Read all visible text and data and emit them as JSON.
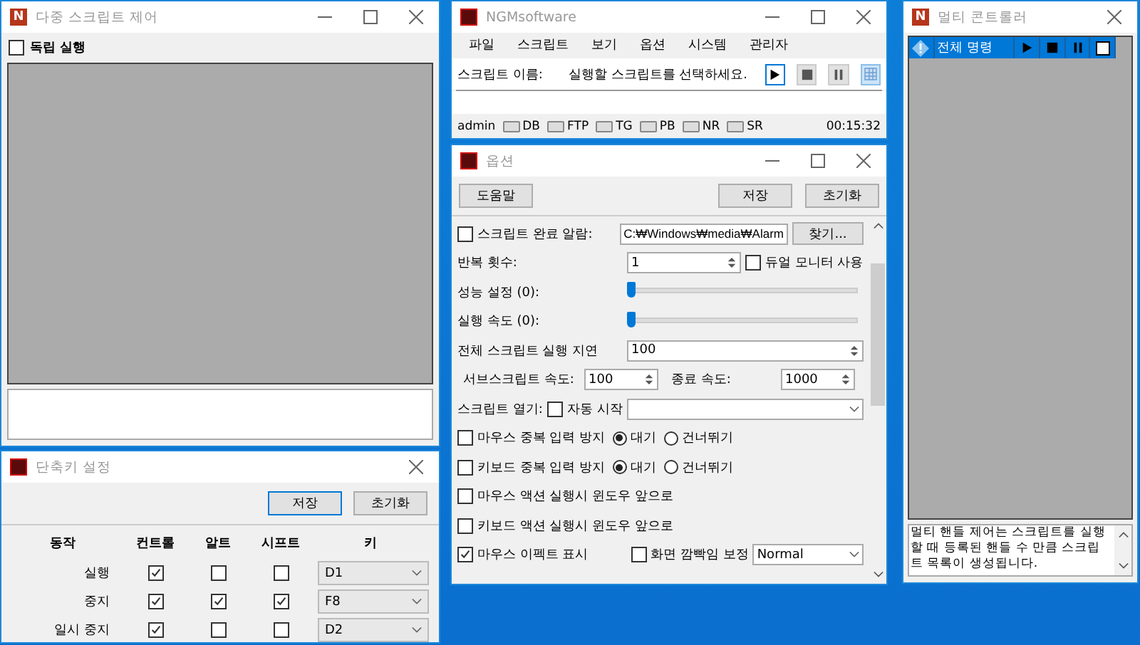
{
  "multi_script_window": {
    "icon_letter": "N",
    "title": "다중 스크립트 제어",
    "independent_run": {
      "label": "독립 실행",
      "checked": false
    }
  },
  "hotkey_window": {
    "title": "단축키 설정",
    "buttons": [
      "저장",
      "초기화"
    ],
    "columns": [
      "동작",
      "컨트롤",
      "알트",
      "시프트",
      "키"
    ],
    "rows": [
      {
        "action": "실행",
        "ctrl": true,
        "alt": false,
        "shift": false,
        "key": "D1"
      },
      {
        "action": "중지",
        "ctrl": true,
        "alt": true,
        "shift": true,
        "key": "F8"
      },
      {
        "action": "일시 중지",
        "ctrl": true,
        "alt": false,
        "shift": false,
        "key": "D2"
      }
    ]
  },
  "main_window": {
    "title": "NGMsoftware",
    "menu": [
      "파일",
      "스크립트",
      "보기",
      "옵션",
      "시스템",
      "관리자"
    ],
    "script_name_label": "스크립트 이름:",
    "script_name_value": "실행할 스크립트를 선택하세요.",
    "status_bar": {
      "user": "admin",
      "indicators": [
        "DB",
        "FTP",
        "TG",
        "PB",
        "NR",
        "SR"
      ],
      "time": "00:15:32"
    }
  },
  "options_window": {
    "title": "옵션",
    "help_button": "도움말",
    "save_button": "저장",
    "reset_button": "초기화",
    "alarm": {
      "label": "스크립트 완료 알람:",
      "checked": false,
      "path": "C:₩Windows₩media₩Alarm",
      "browse_button": "찾기..."
    },
    "repeat": {
      "label": "반복 횟수:",
      "value": "1"
    },
    "dual_monitor": {
      "label": "듀얼 모니터 사용",
      "checked": false
    },
    "performance": {
      "label": "성능 설정 (0):",
      "level": 0
    },
    "speed": {
      "label": "실행 속도 (0):",
      "level": 0
    },
    "total_delay": {
      "label": "전체 스크립트 실행 지연",
      "value": "100"
    },
    "sub_speed": {
      "label": "서브스크립트 속도:",
      "value": "100"
    },
    "end_speed": {
      "label": "종료 속도:",
      "value": "1000"
    },
    "open_script": {
      "label": "스크립트 열기:",
      "auto_start": {
        "label": "자동 시작",
        "checked": false
      }
    },
    "dup_guards": [
      {
        "label": "마우스 중복 입력 방지",
        "checked": false,
        "options": [
          {
            "label": "대기",
            "selected": true
          },
          {
            "label": "건너뛰기",
            "selected": false
          }
        ]
      },
      {
        "label": "키보드 중복 입력 방지",
        "checked": false,
        "options": [
          {
            "label": "대기",
            "selected": true
          },
          {
            "label": "건너뛰기",
            "selected": false
          }
        ]
      }
    ],
    "front_options": [
      {
        "label": "마우스 액션 실행시 윈도우 앞으로",
        "checked": false
      },
      {
        "label": "키보드 액션 실행시 윈도우 앞으로",
        "checked": false
      }
    ],
    "mouse_effect": {
      "label": "마우스 이펙트 표시",
      "checked": true
    },
    "flicker_fix": {
      "label": "화면 깜빡임 보정",
      "checked": false,
      "value": "Normal"
    }
  },
  "multi_controller_window": {
    "icon_letter": "N",
    "title": "멀티 콘트롤러",
    "row": {
      "label": "전체 명령",
      "checked": false
    },
    "description": "멀티 핸들 제어는 스크립트를 실행할 때 등록된 핸들 수 만큼 스크립트 목록이 생성됩니다."
  }
}
